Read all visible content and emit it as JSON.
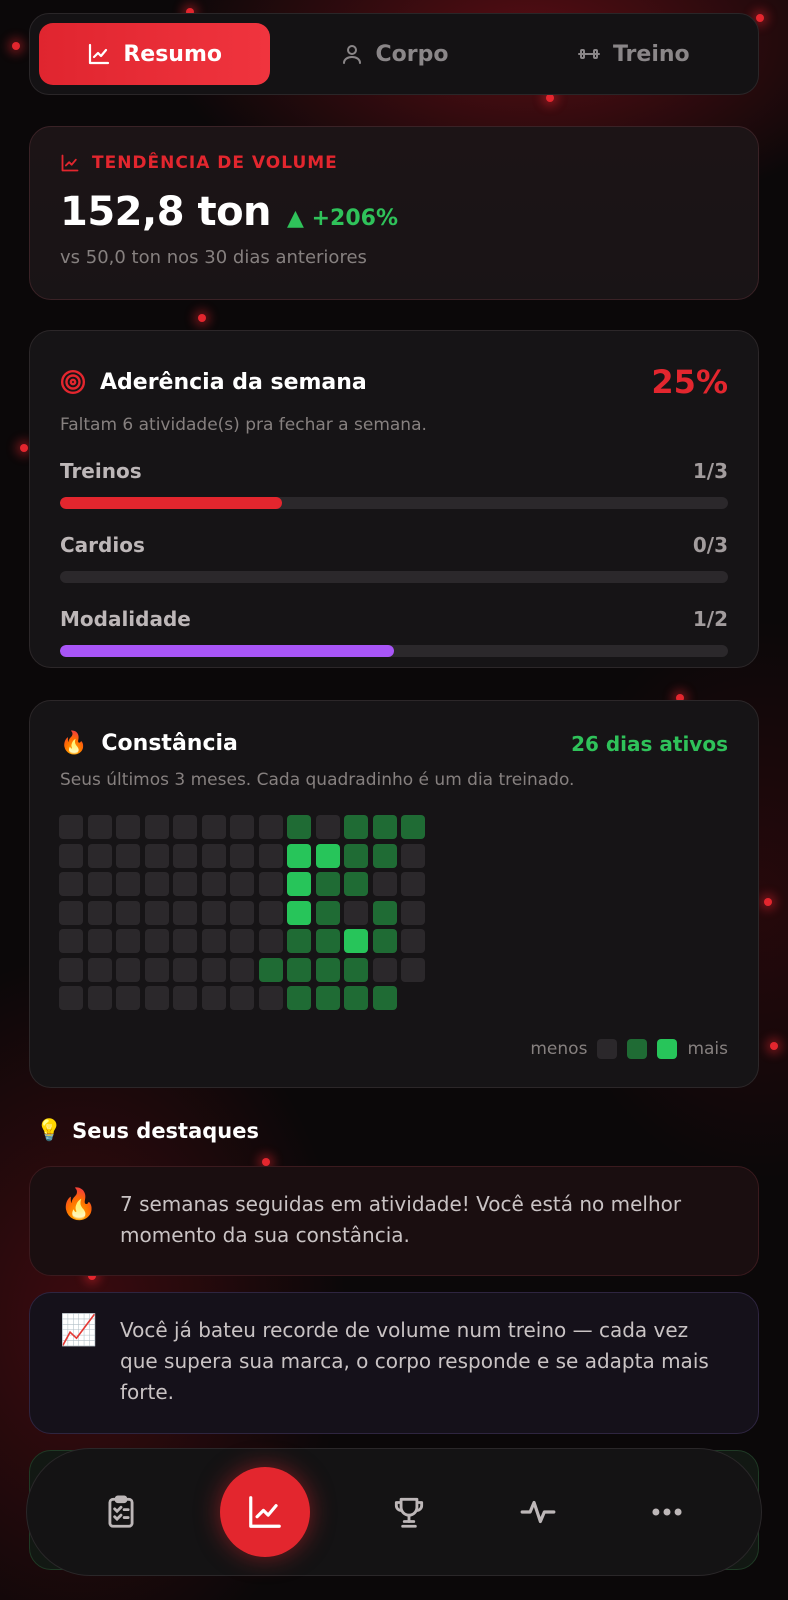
{
  "tabs": [
    {
      "label": "Resumo",
      "icon": "chart-line-icon",
      "active": true
    },
    {
      "label": "Corpo",
      "icon": "user-icon",
      "active": false
    },
    {
      "label": "Treino",
      "icon": "dumbbell-icon",
      "active": false
    }
  ],
  "volume": {
    "heading": "TENDÊNCIA DE VOLUME",
    "value": "152,8 ton",
    "delta": "▲ +206%",
    "comparison": "vs 50,0 ton nos 30 dias anteriores"
  },
  "adherence": {
    "title": "Aderência da semana",
    "percent": "25%",
    "subtitle": "Faltam 6 atividade(s) pra fechar a semana.",
    "bars": [
      {
        "label": "Treinos",
        "count": "1/3",
        "progress": 0.333,
        "color": "#e3262e"
      },
      {
        "label": "Cardios",
        "count": "0/3",
        "progress": 0.0,
        "color": "#e3262e"
      },
      {
        "label": "Modalidade",
        "count": "1/2",
        "progress": 0.5,
        "color": "#a855f7"
      }
    ]
  },
  "constancy": {
    "title": "Constância",
    "active_days": "26 dias ativos",
    "subtitle": "Seus últimos 3 meses. Cada quadradinho é um dia treinado.",
    "legend_less": "menos",
    "legend_more": "mais",
    "weeks": [
      [
        0,
        0,
        0,
        0,
        0,
        0,
        0
      ],
      [
        0,
        0,
        0,
        0,
        0,
        0,
        0
      ],
      [
        0,
        0,
        0,
        0,
        0,
        0,
        0
      ],
      [
        0,
        0,
        0,
        0,
        0,
        0,
        0
      ],
      [
        0,
        0,
        0,
        0,
        0,
        0,
        0
      ],
      [
        0,
        0,
        0,
        0,
        0,
        0,
        0
      ],
      [
        0,
        0,
        0,
        0,
        0,
        0,
        0
      ],
      [
        0,
        0,
        0,
        0,
        0,
        1,
        0
      ],
      [
        1,
        2,
        2,
        2,
        1,
        1,
        1
      ],
      [
        0,
        2,
        1,
        1,
        1,
        1,
        1
      ],
      [
        1,
        1,
        1,
        0,
        2,
        1,
        1
      ],
      [
        1,
        1,
        0,
        1,
        1,
        0,
        1
      ],
      [
        1,
        0,
        0,
        0,
        0,
        0,
        -1
      ]
    ]
  },
  "highlights": {
    "title": "Seus destaques",
    "items": [
      {
        "emoji": "🔥",
        "text": "7 semanas seguidas em atividade! Você está no melhor momento da sua constância."
      },
      {
        "emoji": "📈",
        "text": "Você já bateu recorde de volume num treino — cada vez que supera sua marca, o corpo responde e se adapta mais forte."
      }
    ]
  },
  "nav": [
    {
      "icon": "clipboard-list-icon"
    },
    {
      "icon": "chart-line-icon",
      "active": true
    },
    {
      "icon": "trophy-icon"
    },
    {
      "icon": "activity-pulse-icon"
    },
    {
      "icon": "more-dots-icon"
    }
  ],
  "colors": {
    "accent": "#e3262e",
    "success": "#2fc25a",
    "purple": "#a855f7"
  }
}
